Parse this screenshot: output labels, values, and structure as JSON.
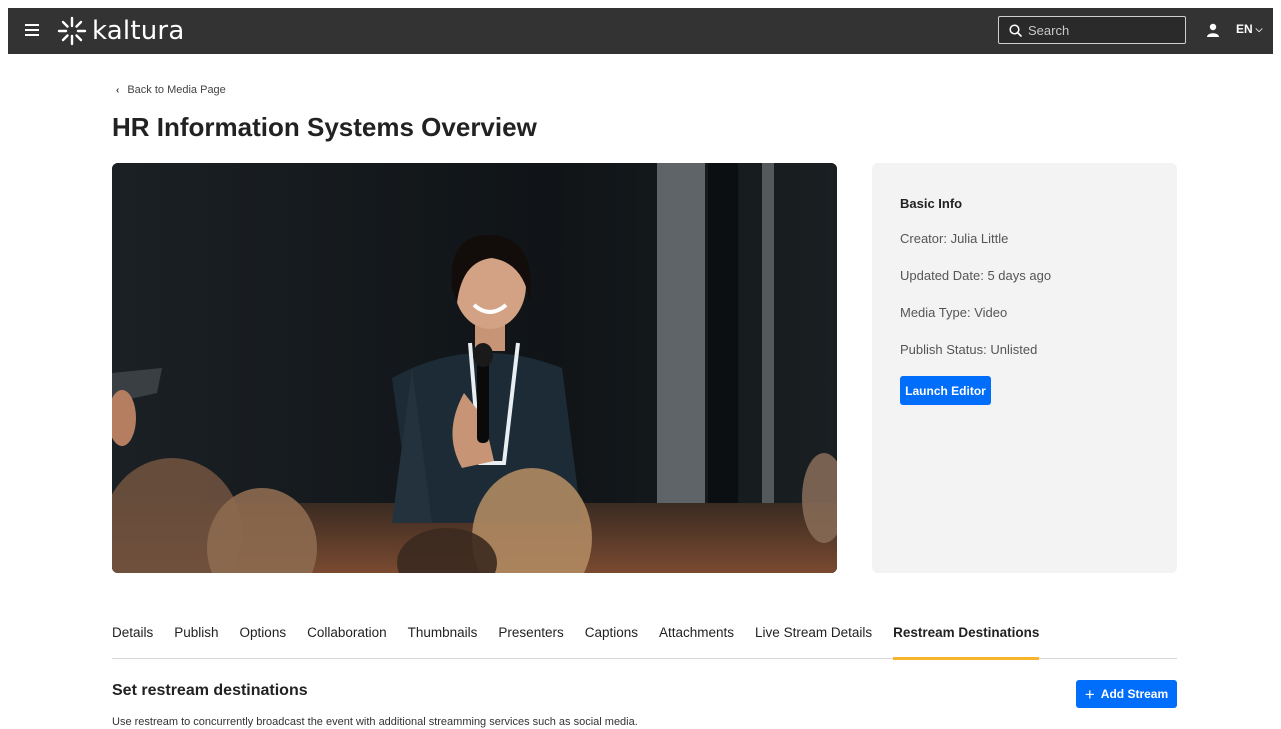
{
  "header": {
    "logo_text": "kaltura",
    "search_placeholder": "Search",
    "language": "EN"
  },
  "breadcrumb": {
    "back_label": "Back to Media Page"
  },
  "page": {
    "title": "HR Information Systems Overview"
  },
  "basic_info": {
    "heading": "Basic Info",
    "creator": "Creator: Julia Little",
    "updated": "Updated Date: 5 days ago",
    "media_type": "Media Type: Video",
    "publish_status": "Publish Status: Unlisted",
    "launch_label": "Launch Editor"
  },
  "tabs": [
    {
      "label": "Details"
    },
    {
      "label": "Publish"
    },
    {
      "label": "Options"
    },
    {
      "label": "Collaboration"
    },
    {
      "label": "Thumbnails"
    },
    {
      "label": "Presenters"
    },
    {
      "label": "Captions"
    },
    {
      "label": "Attachments"
    },
    {
      "label": "Live Stream Details"
    },
    {
      "label": "Restream Destinations"
    }
  ],
  "active_tab": "Restream Destinations",
  "restream": {
    "title": "Set restream destinations",
    "description": "Use restream to concurrently broadcast the event with additional streamming services such as social media.",
    "add_label": "Add Stream"
  },
  "colors": {
    "topbar": "#333333",
    "primary": "#006efa",
    "tab_indicator": "#f7b52c",
    "panel": "#f3f3f3"
  }
}
